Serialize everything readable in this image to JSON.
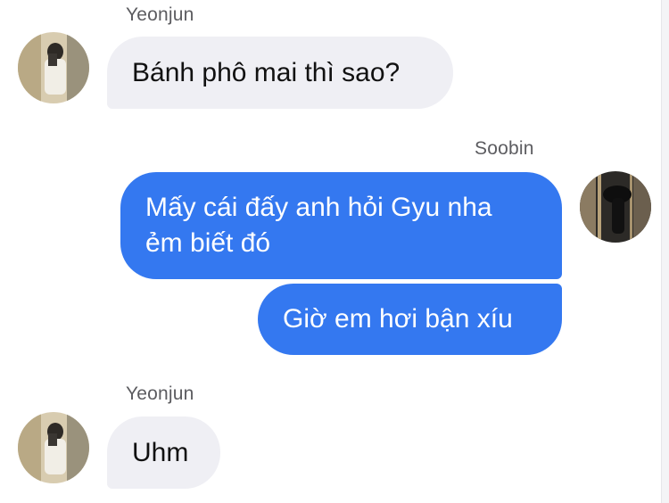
{
  "conversation": {
    "messages": [
      {
        "sender": "Yeonjun",
        "direction": "incoming",
        "avatar_icon": "yeonjun-avatar",
        "text": "Bánh phô mai thì sao?"
      },
      {
        "sender": "Soobin",
        "direction": "outgoing",
        "avatar_icon": "soobin-avatar",
        "text": "Mấy cái đấy anh hỏi Gyu nha\nẻm biết đó"
      },
      {
        "sender": "Soobin",
        "direction": "outgoing",
        "text": "Giờ em hơi bận xíu"
      },
      {
        "sender": "Yeonjun",
        "direction": "incoming",
        "avatar_icon": "yeonjun-avatar",
        "text": "Uhm"
      }
    ]
  },
  "colors": {
    "incoming_bubble": "#efeff4",
    "outgoing_bubble": "#3478f0",
    "sender_name_text": "#5c5c60"
  }
}
